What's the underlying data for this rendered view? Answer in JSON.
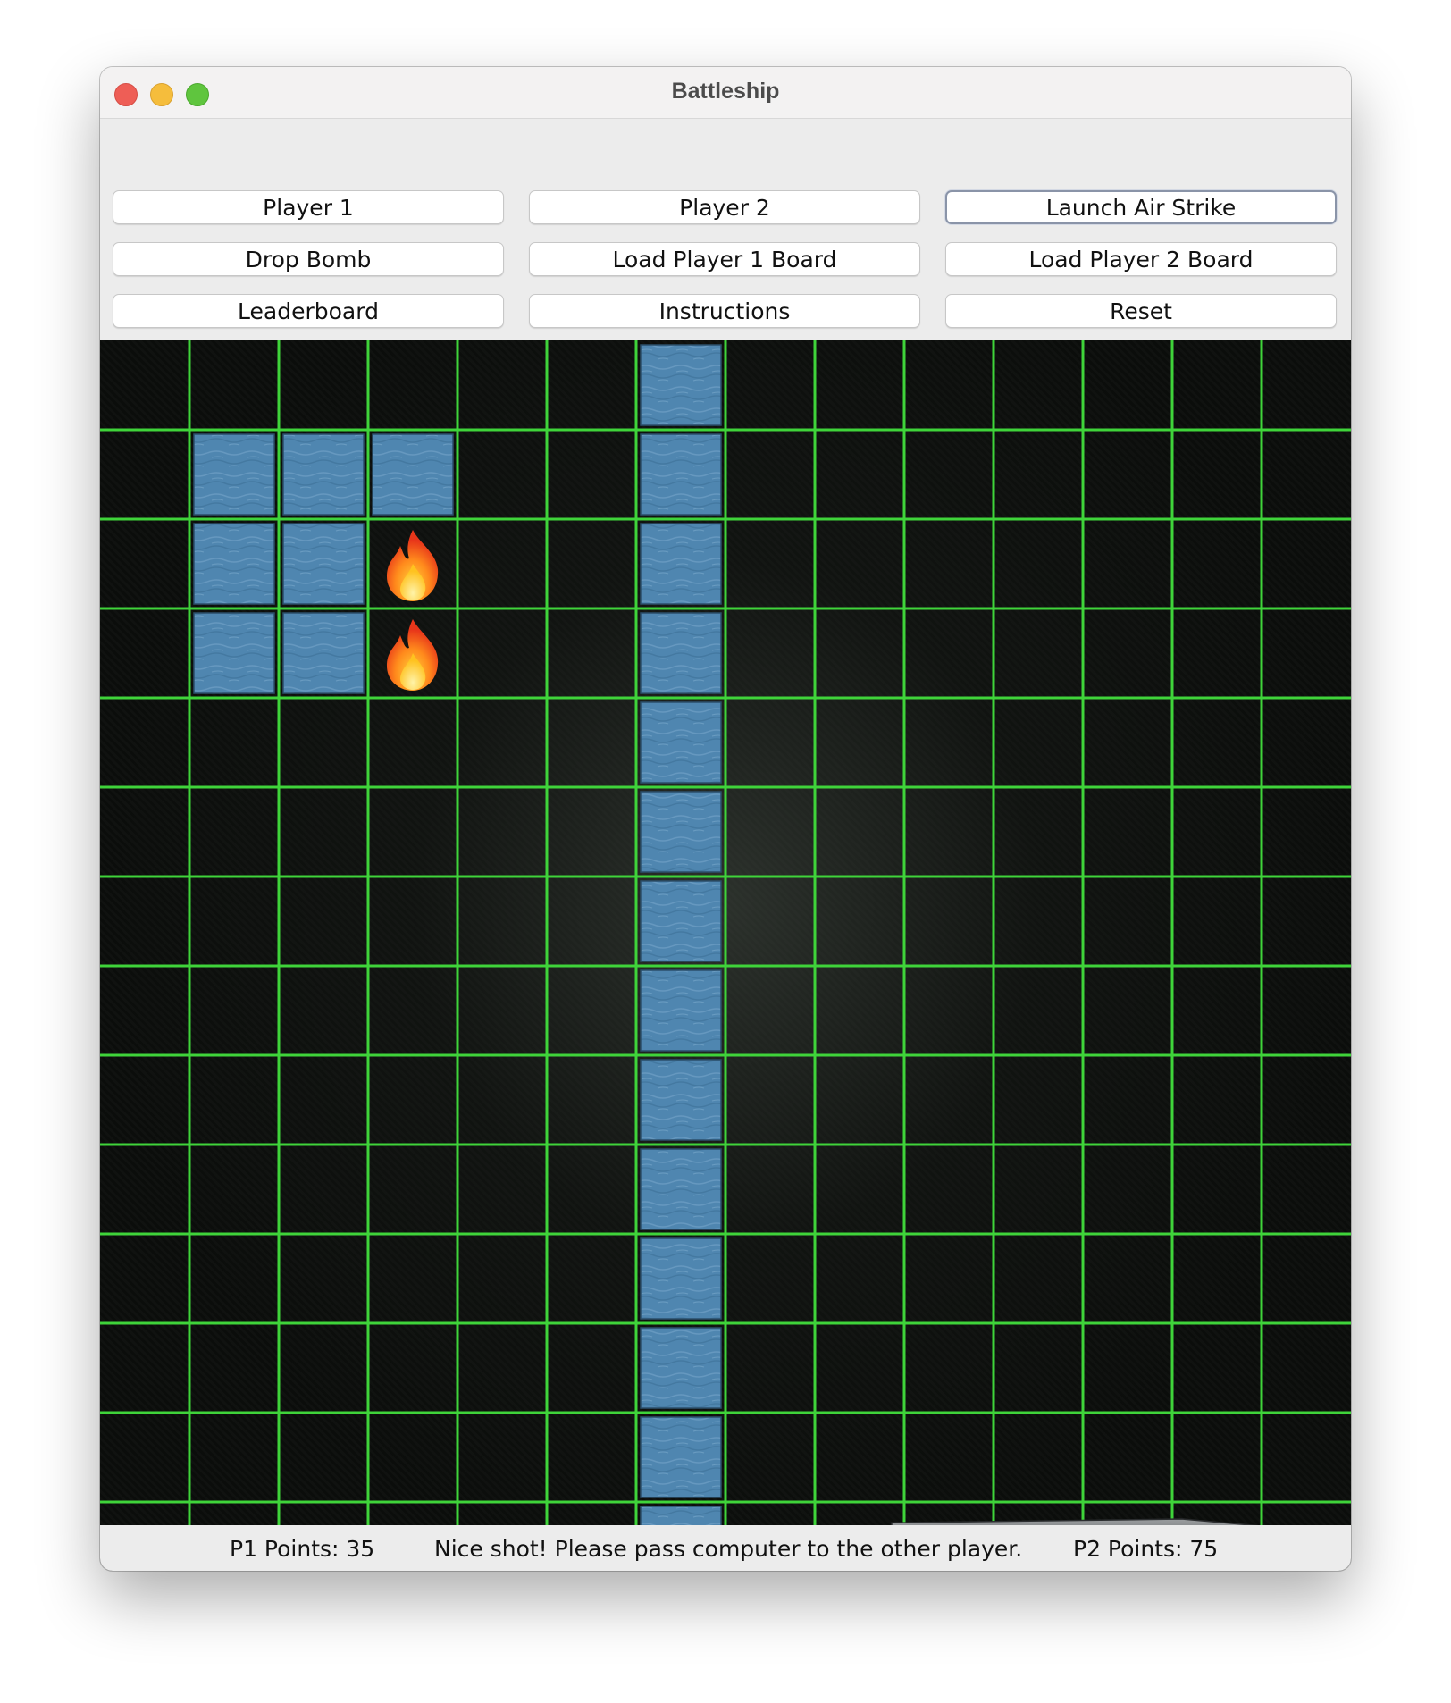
{
  "window": {
    "title": "Battleship"
  },
  "toolbar": {
    "buttons": [
      {
        "label": "Player 1"
      },
      {
        "label": "Player 2"
      },
      {
        "label": "Launch Air Strike"
      },
      {
        "label": "Drop Bomb"
      },
      {
        "label": "Load Player 1 Board"
      },
      {
        "label": "Load Player 2 Board"
      },
      {
        "label": "Leaderboard"
      },
      {
        "label": "Instructions"
      },
      {
        "label": "Reset"
      }
    ]
  },
  "board": {
    "rows": 14,
    "cols": 14,
    "grid_color": "#3fd43a",
    "water_color": "#4f86b0",
    "water_cells": [
      [
        0,
        6
      ],
      [
        1,
        1
      ],
      [
        1,
        2
      ],
      [
        1,
        3
      ],
      [
        1,
        6
      ],
      [
        2,
        1
      ],
      [
        2,
        2
      ],
      [
        2,
        6
      ],
      [
        3,
        1
      ],
      [
        3,
        2
      ],
      [
        3,
        6
      ],
      [
        4,
        6
      ],
      [
        5,
        6
      ],
      [
        6,
        6
      ],
      [
        7,
        6
      ],
      [
        8,
        6
      ],
      [
        9,
        6
      ],
      [
        10,
        6
      ],
      [
        11,
        6
      ],
      [
        12,
        6
      ],
      [
        13,
        6
      ]
    ],
    "hit_cells": [
      [
        2,
        3
      ],
      [
        3,
        3
      ]
    ],
    "hit_icon": "fire-icon",
    "ship_icon": "battleship-icon",
    "ship_row": 13,
    "ship_col_start": 9,
    "ship_col_span": 5
  },
  "status": {
    "p1_points": "P1 Points: 35",
    "message": "Nice shot! Please pass computer to the other player.",
    "p2_points": "P2 Points: 75"
  }
}
